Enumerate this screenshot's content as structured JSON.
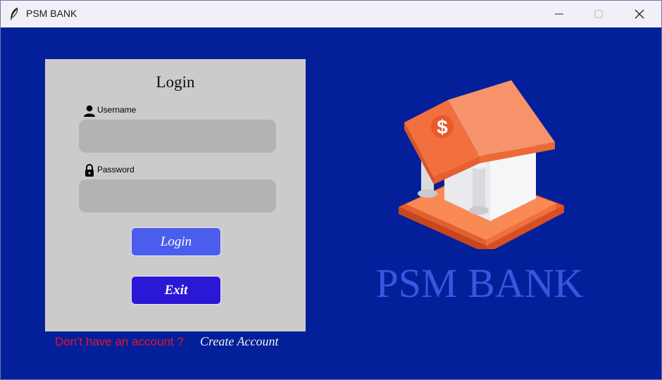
{
  "window": {
    "title": "PSM BANK",
    "icon": "feather-icon",
    "controls": [
      "minimize-icon",
      "maximize-icon",
      "close-icon"
    ]
  },
  "login_form": {
    "title": "Login",
    "username": {
      "label": "Username",
      "value": "",
      "icon": "user-icon"
    },
    "password": {
      "label": "Password",
      "value": "",
      "icon": "lock-icon"
    },
    "login_button": "Login",
    "exit_button": "Exit"
  },
  "footer": {
    "prompt": "Don't have an account ?",
    "create_account": "Create Account"
  },
  "brand": {
    "name": "PSM BANK",
    "illustration": "bank-building-icon"
  },
  "colors": {
    "background": "#03209a",
    "panel": "#cdcbca",
    "input": "#b3b3b3",
    "login_button": "#4b5ded",
    "exit_button": "#2b17d6",
    "prompt_text": "#e8112d",
    "brand_text": "#3757e0",
    "roof": "#f26f3e"
  }
}
